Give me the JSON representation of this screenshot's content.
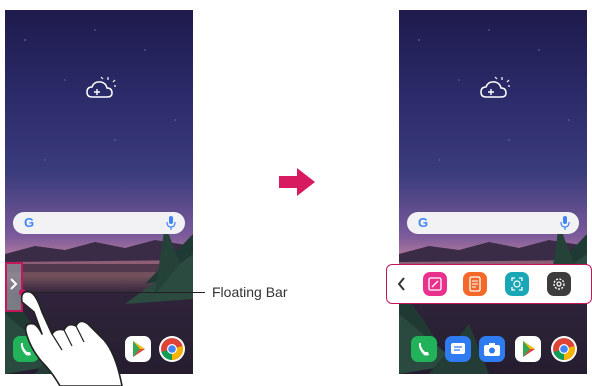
{
  "callout": {
    "label": "Floating Bar"
  },
  "left_phone": {
    "search_logo": "G",
    "dock_apps": [
      "phone-icon",
      "play-store-icon",
      "chrome-icon"
    ]
  },
  "right_phone": {
    "search_logo": "G",
    "dock_apps": [
      "phone-icon",
      "messages-icon",
      "camera-icon",
      "play-store-icon",
      "chrome-icon"
    ]
  },
  "floating_bar": {
    "items": [
      "back-chevron-icon",
      "note-icon",
      "memo-icon",
      "screen-capture-icon",
      "settings-icon"
    ],
    "colors": {
      "note": "#e8318c",
      "memo": "#f2692a",
      "capture": "#1aa7b5",
      "settings": "#3c3c3c"
    }
  },
  "colors": {
    "accent": "#c2185b",
    "arrow": "#d81b60"
  }
}
